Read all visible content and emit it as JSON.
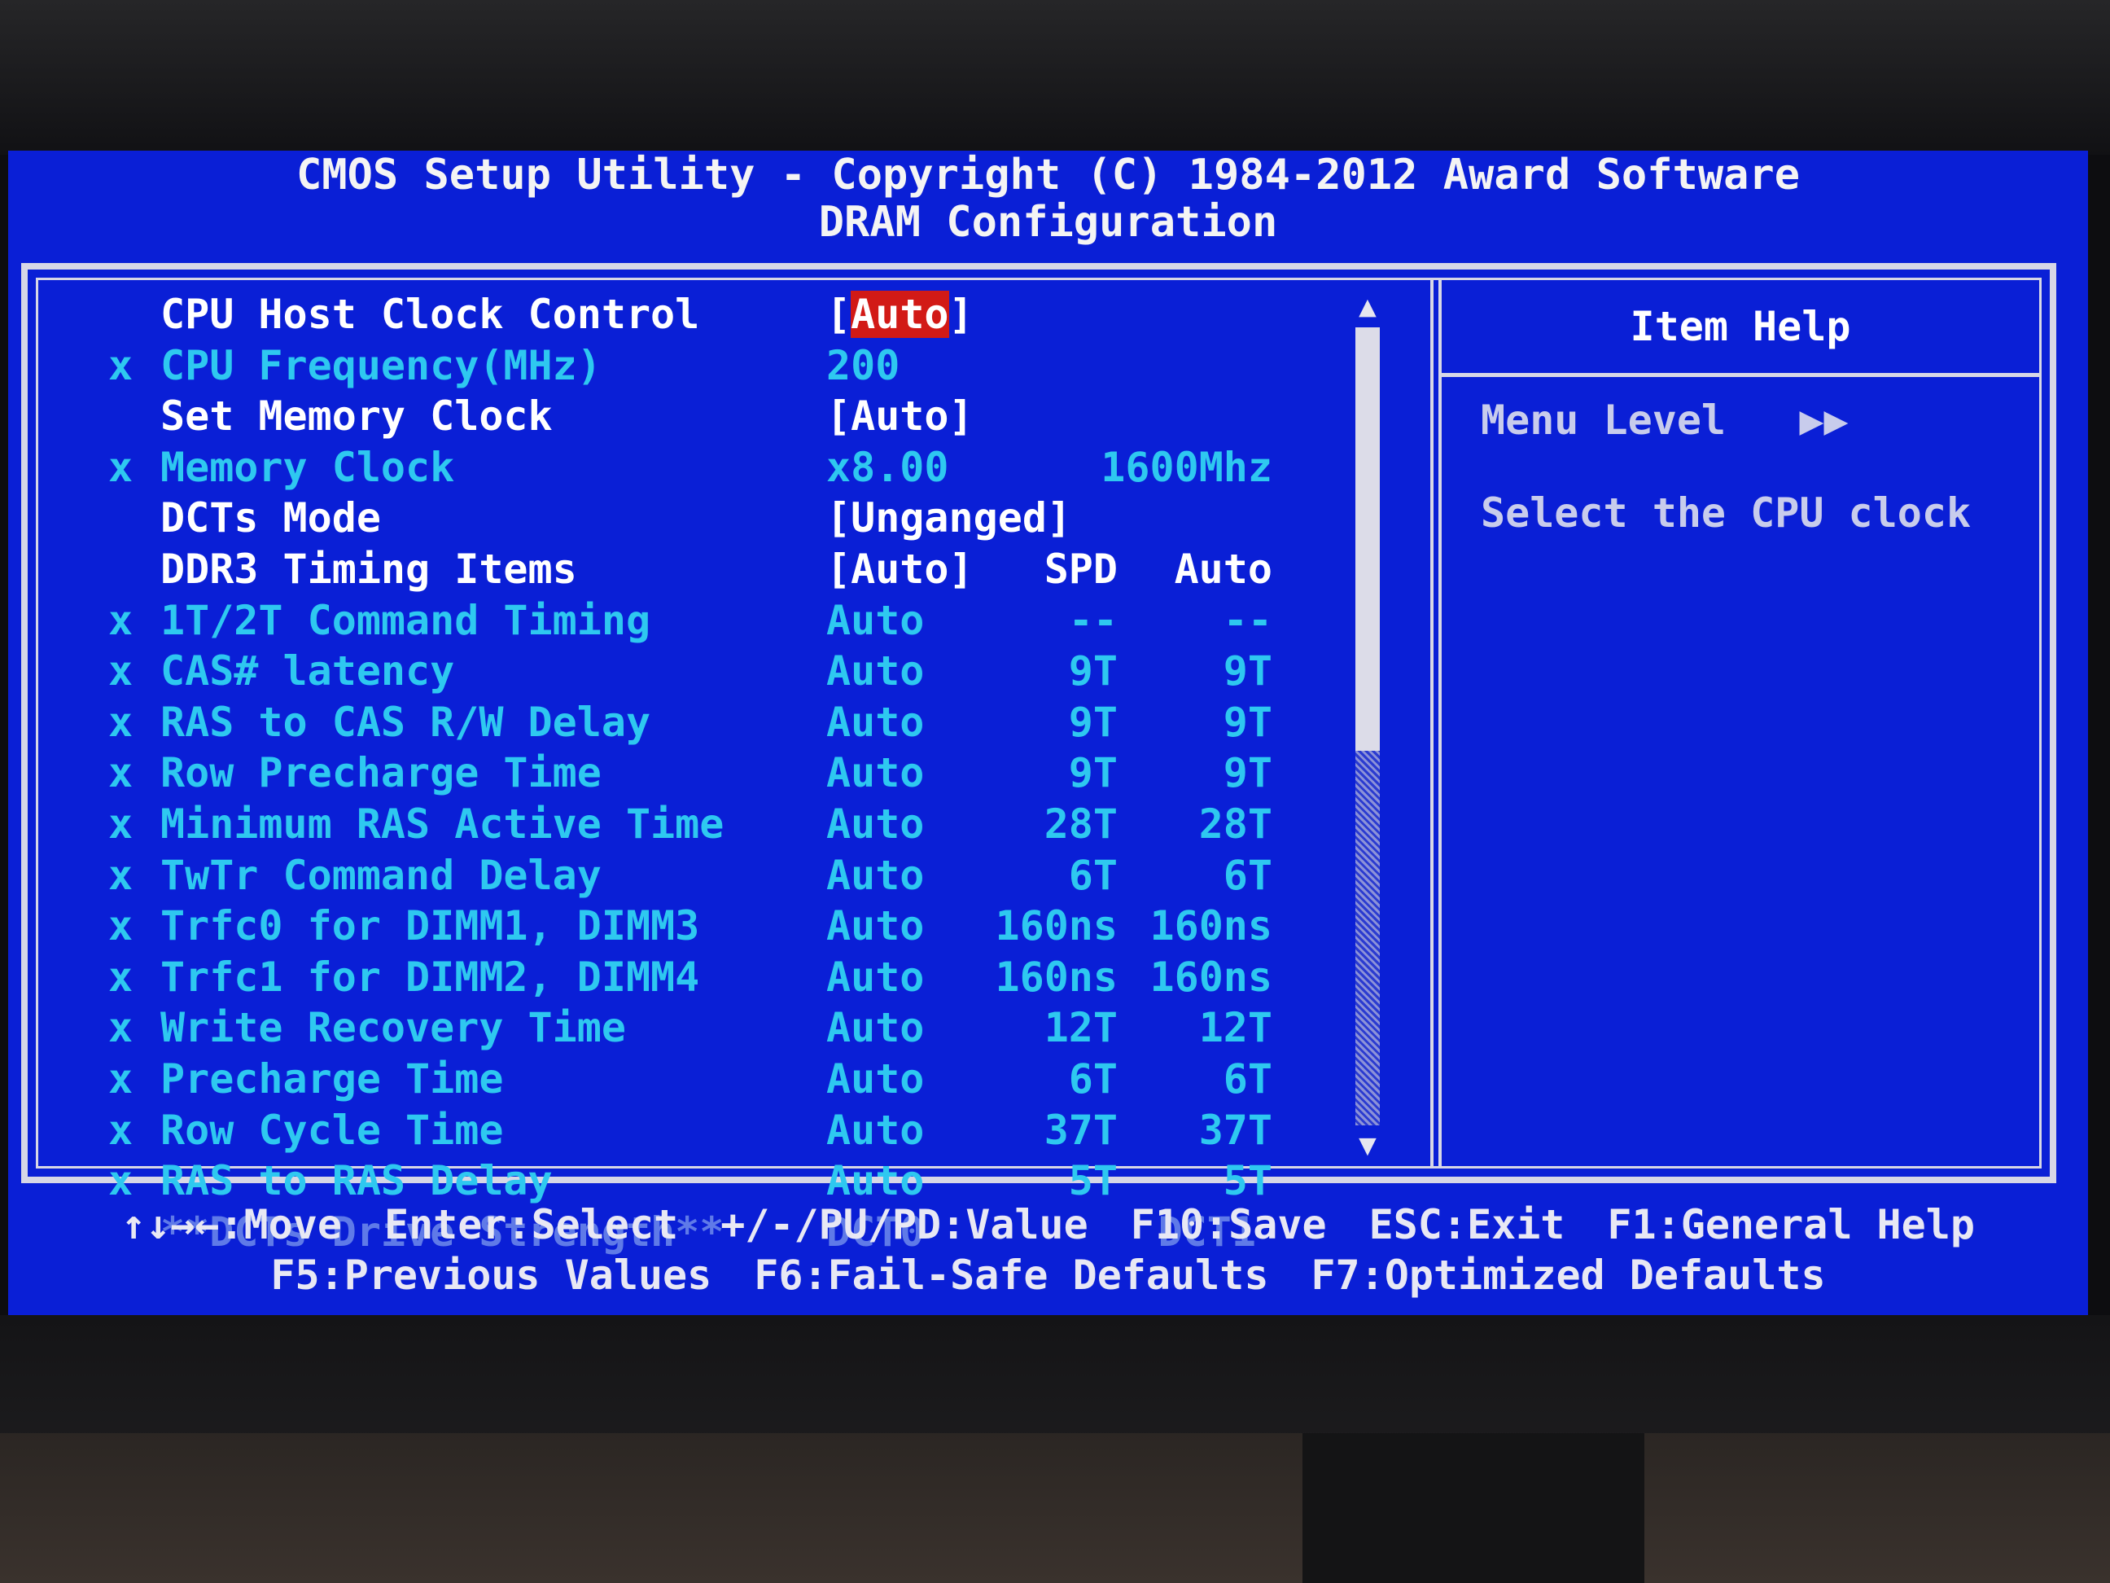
{
  "header": {
    "title": "CMOS Setup Utility - Copyright (C) 1984-2012 Award Software",
    "subtitle": "DRAM Configuration"
  },
  "settings": [
    {
      "mark": "",
      "label": "CPU Host Clock Control",
      "value_prefix": "[",
      "value": "Auto",
      "value_suffix": "]",
      "spd": "",
      "auto": "",
      "state": "selected"
    },
    {
      "mark": "x",
      "label": "CPU Frequency(MHz)",
      "value": "200",
      "spd": "",
      "auto": "",
      "state": "locked"
    },
    {
      "mark": "",
      "label": "Set Memory Clock",
      "value": "[Auto]",
      "spd": "",
      "auto": "",
      "state": "active"
    },
    {
      "mark": "x",
      "label": "Memory Clock",
      "value": "x8.00",
      "spd": "",
      "auto": "1600Mhz",
      "state": "locked"
    },
    {
      "mark": "",
      "label": "DCTs Mode",
      "value": "[Unganged]",
      "spd": "",
      "auto": "",
      "state": "active"
    },
    {
      "mark": "",
      "label": "DDR3 Timing Items",
      "value": "[Auto]",
      "spd": "SPD",
      "auto": "Auto",
      "state": "active"
    },
    {
      "mark": "x",
      "label": "1T/2T Command Timing",
      "value": "Auto",
      "spd": "--",
      "auto": "--",
      "state": "locked"
    },
    {
      "mark": "x",
      "label": "CAS# latency",
      "value": "Auto",
      "spd": "9T",
      "auto": "9T",
      "state": "locked"
    },
    {
      "mark": "x",
      "label": "RAS to CAS R/W Delay",
      "value": "Auto",
      "spd": "9T",
      "auto": "9T",
      "state": "locked"
    },
    {
      "mark": "x",
      "label": "Row Precharge Time",
      "value": "Auto",
      "spd": "9T",
      "auto": "9T",
      "state": "locked"
    },
    {
      "mark": "x",
      "label": "Minimum RAS Active Time",
      "value": "Auto",
      "spd": "28T",
      "auto": "28T",
      "state": "locked"
    },
    {
      "mark": "x",
      "label": "TwTr Command Delay",
      "value": "Auto",
      "spd": "6T",
      "auto": "6T",
      "state": "locked"
    },
    {
      "mark": "x",
      "label": "Trfc0 for DIMM1, DIMM3",
      "value": "Auto",
      "spd": "160ns",
      "auto": "160ns",
      "state": "locked"
    },
    {
      "mark": "x",
      "label": "Trfc1 for DIMM2, DIMM4",
      "value": "Auto",
      "spd": "160ns",
      "auto": "160ns",
      "state": "locked"
    },
    {
      "mark": "x",
      "label": "Write Recovery Time",
      "value": "Auto",
      "spd": "12T",
      "auto": "12T",
      "state": "locked"
    },
    {
      "mark": "x",
      "label": "Precharge Time",
      "value": "Auto",
      "spd": "6T",
      "auto": "6T",
      "state": "locked"
    },
    {
      "mark": "x",
      "label": "Row Cycle Time",
      "value": "Auto",
      "spd": "37T",
      "auto": "37T",
      "state": "locked"
    },
    {
      "mark": "x",
      "label": "RAS to RAS Delay",
      "value": "Auto",
      "spd": "5T",
      "auto": "5T",
      "state": "locked"
    },
    {
      "mark": "",
      "label": "**DCTs Drive Strength**",
      "value": "DCT0",
      "spd": "DCT1",
      "auto": "",
      "state": "dim"
    }
  ],
  "scrollbar": {
    "up_glyph": "▲",
    "down_glyph": "▼"
  },
  "help": {
    "title": "Item Help",
    "menu_level": "Menu Level   ▶▶",
    "text": "Select the CPU clock"
  },
  "footer": {
    "line1": [
      "↑↓→←:Move",
      "Enter:Select",
      "+/-/PU/PD:Value",
      "F10:Save",
      "ESC:Exit",
      "F1:General Help"
    ],
    "line2": [
      "F5:Previous Values",
      "F6:Fail-Safe Defaults",
      "F7:Optimized Defaults"
    ]
  },
  "colors": {
    "screen_bg": "#0a1fd6",
    "active_text": "#ffffff",
    "locked_text": "#2ec8f0",
    "highlight": "#d21a16"
  }
}
